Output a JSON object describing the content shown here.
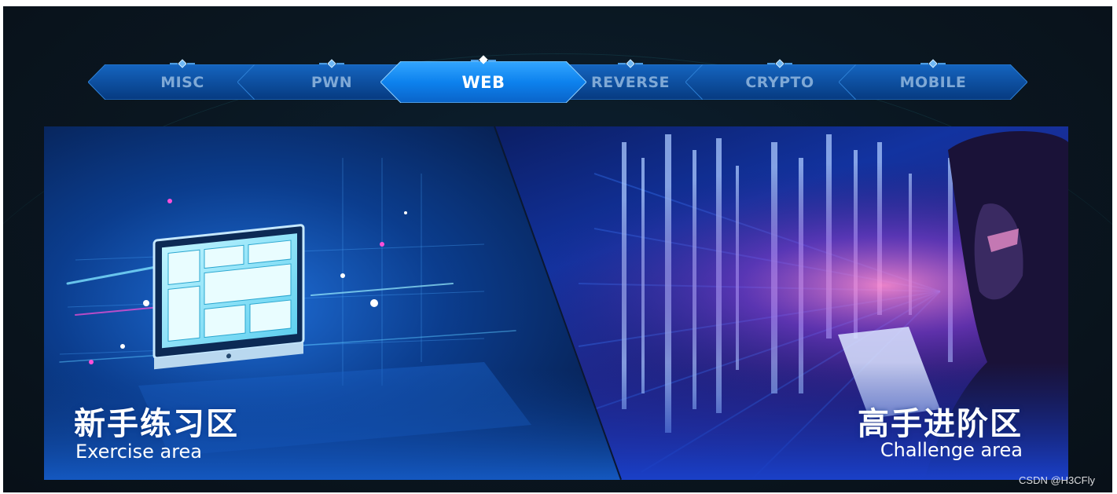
{
  "tabs": [
    {
      "label": "MISC",
      "active": false
    },
    {
      "label": "PWN",
      "active": false
    },
    {
      "label": "WEB",
      "active": true
    },
    {
      "label": "REVERSE",
      "active": false
    },
    {
      "label": "CRYPTO",
      "active": false
    },
    {
      "label": "MOBILE",
      "active": false
    }
  ],
  "panels": {
    "exercise": {
      "title": "新手练习区",
      "subtitle": "Exercise area"
    },
    "challenge": {
      "title": "高手进阶区",
      "subtitle": "Challenge area"
    }
  },
  "watermark": "CSDN @H3CFly",
  "colors": {
    "tab_idle": "#0b4a9a",
    "tab_active": "#0f86f0",
    "panel_left": "#0b3d8e",
    "panel_right": "#1a2f8a",
    "background": "#0a1620"
  },
  "icons": [
    "monitor-illustration",
    "binary-stream-illustration",
    "hooded-hacker-illustration"
  ]
}
